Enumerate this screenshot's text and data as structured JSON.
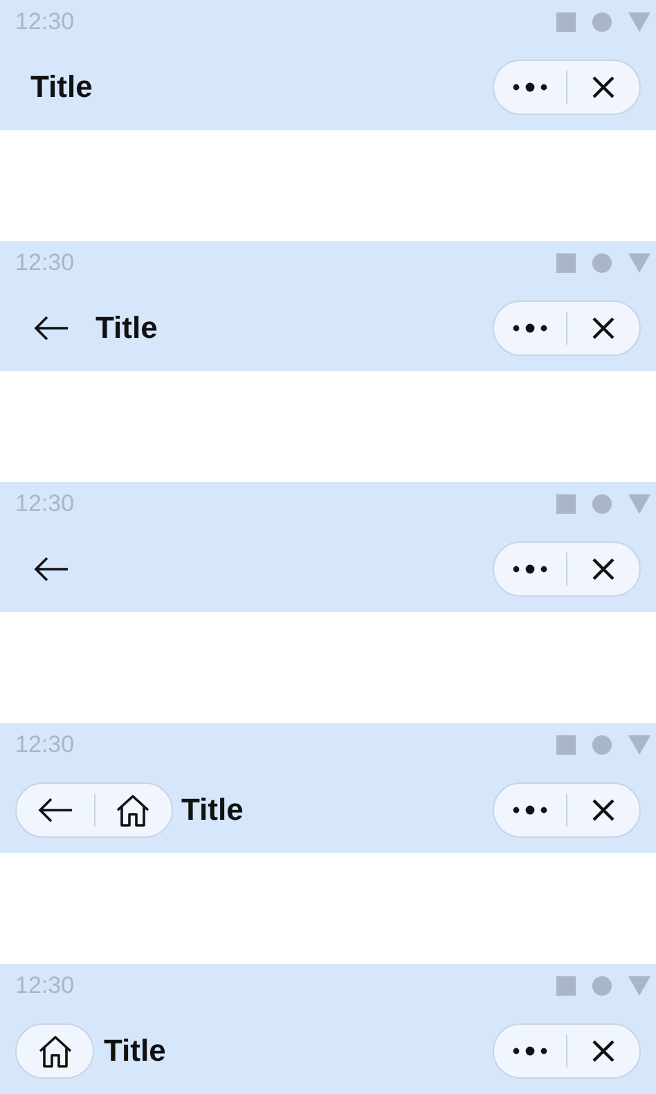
{
  "bars": [
    {
      "time": "12:30",
      "kind": "none",
      "title": "Title"
    },
    {
      "time": "12:30",
      "kind": "back",
      "title": "Title"
    },
    {
      "time": "12:30",
      "kind": "back"
    },
    {
      "time": "12:30",
      "kind": "backhome",
      "title": "Title"
    },
    {
      "time": "12:30",
      "kind": "home",
      "title": "Title"
    }
  ]
}
